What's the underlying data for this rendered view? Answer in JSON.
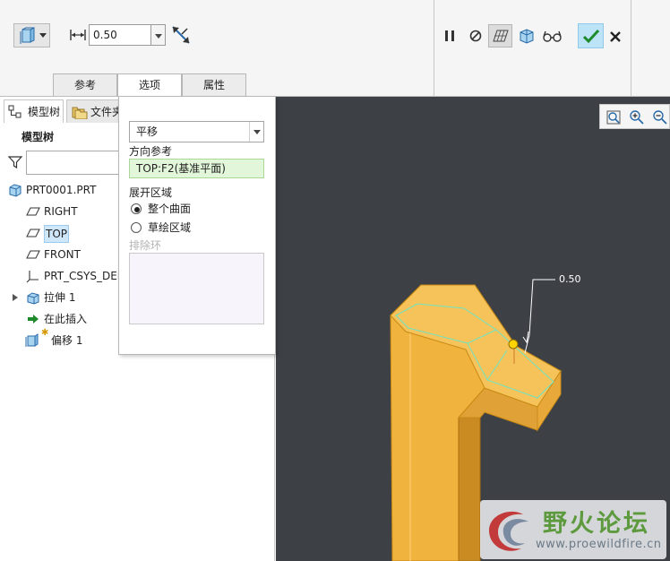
{
  "dashboard": {
    "distance_value": "0.50",
    "tabs": [
      {
        "label": "参考"
      },
      {
        "label": "选项"
      },
      {
        "label": "属性"
      }
    ]
  },
  "left_panel": {
    "tabs": [
      {
        "label": "模型树"
      },
      {
        "label": "文件夹浏览器"
      }
    ],
    "tree_title": "模型树",
    "items": [
      {
        "label": "PRT0001.PRT"
      },
      {
        "label": "RIGHT"
      },
      {
        "label": "TOP"
      },
      {
        "label": "FRONT"
      },
      {
        "label": "PRT_CSYS_DEF"
      },
      {
        "label": "拉伸 1"
      },
      {
        "label": "在此插入"
      },
      {
        "label": "偏移 1"
      }
    ]
  },
  "options_popup": {
    "mode_value": "平移",
    "direction_ref_label": "方向参考",
    "direction_ref_value": "TOP:F2(基准平面)",
    "expand_area_label": "展开区域",
    "radio_whole": "整个曲面",
    "radio_sketch": "草绘区域",
    "exclude_label": "排除环"
  },
  "viewport": {
    "dimension_label": "0.50"
  },
  "watermark": {
    "title": "野火论坛",
    "url": "www.proewildfire.cn"
  },
  "colors": {
    "viewport_bg": "#3d4146",
    "model_fill": "#f0b33e",
    "highlight_edge": "#6fe3c3",
    "ok_button_bg": "#bde3f7",
    "selected_ref_bg": "#e2f6d9"
  }
}
